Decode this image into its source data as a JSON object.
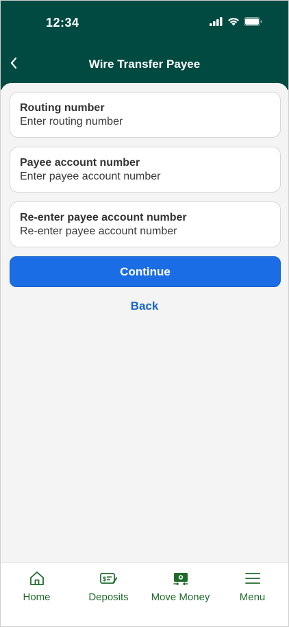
{
  "status_bar": {
    "time": "12:34",
    "icons": [
      "cellular-signal-icon",
      "wifi-icon",
      "battery-icon"
    ]
  },
  "header": {
    "title": "Wire Transfer Payee",
    "back_icon": "chevron-left-icon"
  },
  "form": {
    "fields": [
      {
        "label": "Routing number",
        "placeholder": "Enter routing number",
        "value": ""
      },
      {
        "label": "Payee account number",
        "placeholder": "Enter payee account number",
        "value": ""
      },
      {
        "label": "Re-enter payee account number",
        "placeholder": "Re-enter payee account number",
        "value": ""
      }
    ],
    "continue_label": "Continue",
    "back_label": "Back"
  },
  "tab_bar": {
    "items": [
      {
        "label": "Home",
        "icon": "home-icon"
      },
      {
        "label": "Deposits",
        "icon": "check-deposit-icon"
      },
      {
        "label": "Move Money",
        "icon": "money-transfer-icon"
      },
      {
        "label": "Menu",
        "icon": "hamburger-menu-icon"
      }
    ]
  },
  "colors": {
    "header_bg": "#004a41",
    "primary_button": "#1a6de4",
    "link": "#1866c9",
    "tab_accent": "#1e6b2a",
    "content_bg": "#f4f4f4"
  }
}
